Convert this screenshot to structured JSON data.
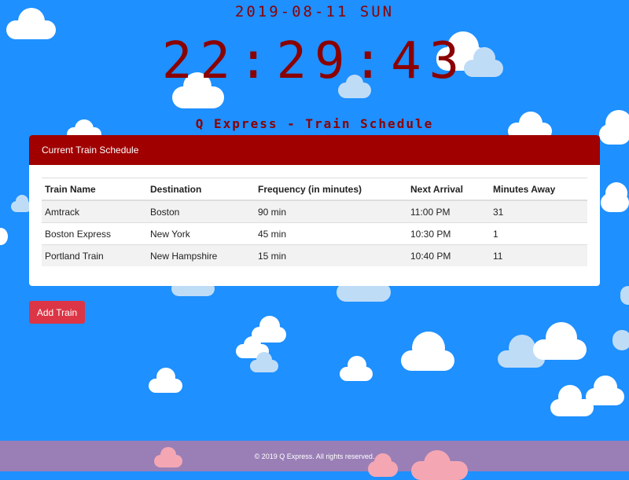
{
  "header": {
    "date": "2019-08-11 SUN",
    "time": "22:29:43",
    "subtitle": "Q Express - Train Schedule"
  },
  "schedule": {
    "title": "Current Train Schedule",
    "columns": [
      "Train Name",
      "Destination",
      "Frequency (in minutes)",
      "Next Arrival",
      "Minutes Away"
    ],
    "rows": [
      [
        "Amtrack",
        "Boston",
        "90 min",
        "11:00 PM",
        "31"
      ],
      [
        "Boston Express",
        "New York",
        "45 min",
        "10:30 PM",
        "1"
      ],
      [
        "Portland Train",
        "New Hampshire",
        "15 min",
        "10:40 PM",
        "11"
      ]
    ]
  },
  "actions": {
    "add_train_label": "Add Train"
  },
  "footer": {
    "text": "© 2019 Q Express. All rights reserved."
  },
  "colors": {
    "background": "#1e90ff",
    "accent": "#a00000",
    "button": "#dc3545",
    "footer": "#9a7fb6",
    "cloud_white": "#ffffff",
    "cloud_light_blue": "#bfdcf7",
    "cloud_pink": "#f4a7b3"
  }
}
